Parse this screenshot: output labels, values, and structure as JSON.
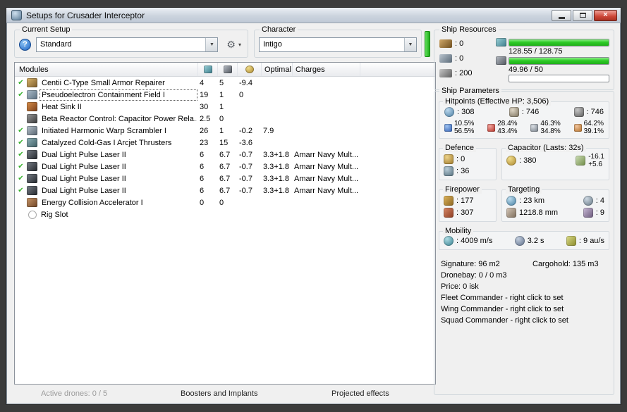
{
  "window": {
    "title": "Setups for Crusader Interceptor"
  },
  "setup_group": {
    "label": "Current Setup",
    "selected": "Standard"
  },
  "character_group": {
    "label": "Character",
    "selected": "Intigo"
  },
  "ship_resources": {
    "label": "Ship Resources",
    "turrets": ": 0",
    "launchers": ": 0",
    "calibration": ": 200",
    "cpu": {
      "text": "128.55 / 128.75",
      "pct": 99.8
    },
    "powergrid": {
      "text": "49.96 / 50",
      "pct": 99.9
    },
    "upgrade": {
      "pct": 0
    }
  },
  "modules_table": {
    "columns": {
      "modules": "Modules",
      "optimal": "Optimal",
      "charges": "Charges"
    },
    "rows": [
      {
        "check": true,
        "icon": "armor-repairer",
        "name": "Centii C-Type Small Armor Repairer",
        "cpu": "4",
        "pg": "5",
        "cap": "-9.4",
        "optimal": "",
        "charges": ""
      },
      {
        "check": true,
        "icon": "containment-field",
        "name": "Pseudoelectron Containment Field I",
        "cpu": "19",
        "pg": "1",
        "cap": "0",
        "optimal": "",
        "charges": "",
        "selected": true
      },
      {
        "check": false,
        "icon": "heat-sink",
        "name": "Heat Sink II",
        "cpu": "30",
        "pg": "1",
        "cap": "",
        "optimal": "",
        "charges": ""
      },
      {
        "check": false,
        "icon": "reactor-control",
        "name": "Beta Reactor Control: Capacitor Power Rela...",
        "cpu": "2.5",
        "pg": "0",
        "cap": "",
        "optimal": "",
        "charges": ""
      },
      {
        "check": true,
        "icon": "warp-scrambler",
        "name": "Initiated Harmonic Warp Scrambler I",
        "cpu": "26",
        "pg": "1",
        "cap": "-0.2",
        "optimal": "7.9",
        "charges": ""
      },
      {
        "check": true,
        "icon": "afterburner",
        "name": "Catalyzed Cold-Gas I Arcjet Thrusters",
        "cpu": "23",
        "pg": "15",
        "cap": "-3.6",
        "optimal": "",
        "charges": ""
      },
      {
        "check": true,
        "icon": "pulse-laser",
        "name": "Dual Light Pulse Laser II",
        "cpu": "6",
        "pg": "6.7",
        "cap": "-0.7",
        "optimal": "3.3+1.8",
        "charges": "Amarr Navy Mult..."
      },
      {
        "check": true,
        "icon": "pulse-laser",
        "name": "Dual Light Pulse Laser II",
        "cpu": "6",
        "pg": "6.7",
        "cap": "-0.7",
        "optimal": "3.3+1.8",
        "charges": "Amarr Navy Mult..."
      },
      {
        "check": true,
        "icon": "pulse-laser",
        "name": "Dual Light Pulse Laser II",
        "cpu": "6",
        "pg": "6.7",
        "cap": "-0.7",
        "optimal": "3.3+1.8",
        "charges": "Amarr Navy Mult..."
      },
      {
        "check": true,
        "icon": "pulse-laser",
        "name": "Dual Light Pulse Laser II",
        "cpu": "6",
        "pg": "6.7",
        "cap": "-0.7",
        "optimal": "3.3+1.8",
        "charges": "Amarr Navy Mult..."
      },
      {
        "check": false,
        "icon": "rig-module",
        "name": "Energy Collision Accelerator I",
        "cpu": "0",
        "pg": "0",
        "cap": "",
        "optimal": "",
        "charges": ""
      },
      {
        "check": false,
        "icon": "empty-rig",
        "name": "Rig Slot",
        "cpu": "",
        "pg": "",
        "cap": "",
        "optimal": "",
        "charges": ""
      }
    ]
  },
  "ship_parameters": {
    "label": "Ship Parameters",
    "hitpoints": {
      "label": "Hitpoints (Effective HP: 3,506)",
      "shield": ": 308",
      "armor": ": 746",
      "hull": ": 746",
      "resists": [
        {
          "type": "em",
          "top": "10.5%",
          "bottom": "56.5%"
        },
        {
          "type": "thermal",
          "top": "28.4%",
          "bottom": "43.4%"
        },
        {
          "type": "kinetic",
          "top": "46.3%",
          "bottom": "34.8%"
        },
        {
          "type": "explosive",
          "top": "64.2%",
          "bottom": "39.1%"
        }
      ]
    },
    "defence": {
      "label": "Defence",
      "passive": ": 0",
      "active": ": 36"
    },
    "capacitor": {
      "label": "Capacitor (Lasts: 32s)",
      "amount": ": 380",
      "drain": "-16.1",
      "recharge": "+5.6"
    },
    "firepower": {
      "label": "Firepower",
      "volley": ": 177",
      "dps": ": 307"
    },
    "targeting": {
      "label": "Targeting",
      "range": ": 23 km",
      "max_targets": ": 4",
      "sig_resolution": "1218.8 mm",
      "sensor_strength": ": 9"
    },
    "mobility": {
      "label": "Mobility",
      "speed": ": 4009 m/s",
      "align_time": "3.2 s",
      "warp_speed": ": 9 au/s"
    },
    "info_lines": [
      {
        "parts": [
          "Signature: 96 m2",
          "Cargohold: 135 m3"
        ],
        "interactable": false
      },
      {
        "parts": [
          "Dronebay: 0 / 0 m3"
        ],
        "interactable": false
      },
      {
        "parts": [
          "Price: 0 isk"
        ],
        "interactable": false
      },
      {
        "parts": [
          "Fleet Commander - right click to set"
        ],
        "interactable": true
      },
      {
        "parts": [
          "Wing Commander - right click to set"
        ],
        "interactable": true
      },
      {
        "parts": [
          "Squad Commander - right click to set"
        ],
        "interactable": true
      }
    ]
  },
  "bottom_bar": {
    "active_drones": "Active drones: 0 / 5",
    "boosters": "Boosters and Implants",
    "projected": "Projected effects"
  }
}
